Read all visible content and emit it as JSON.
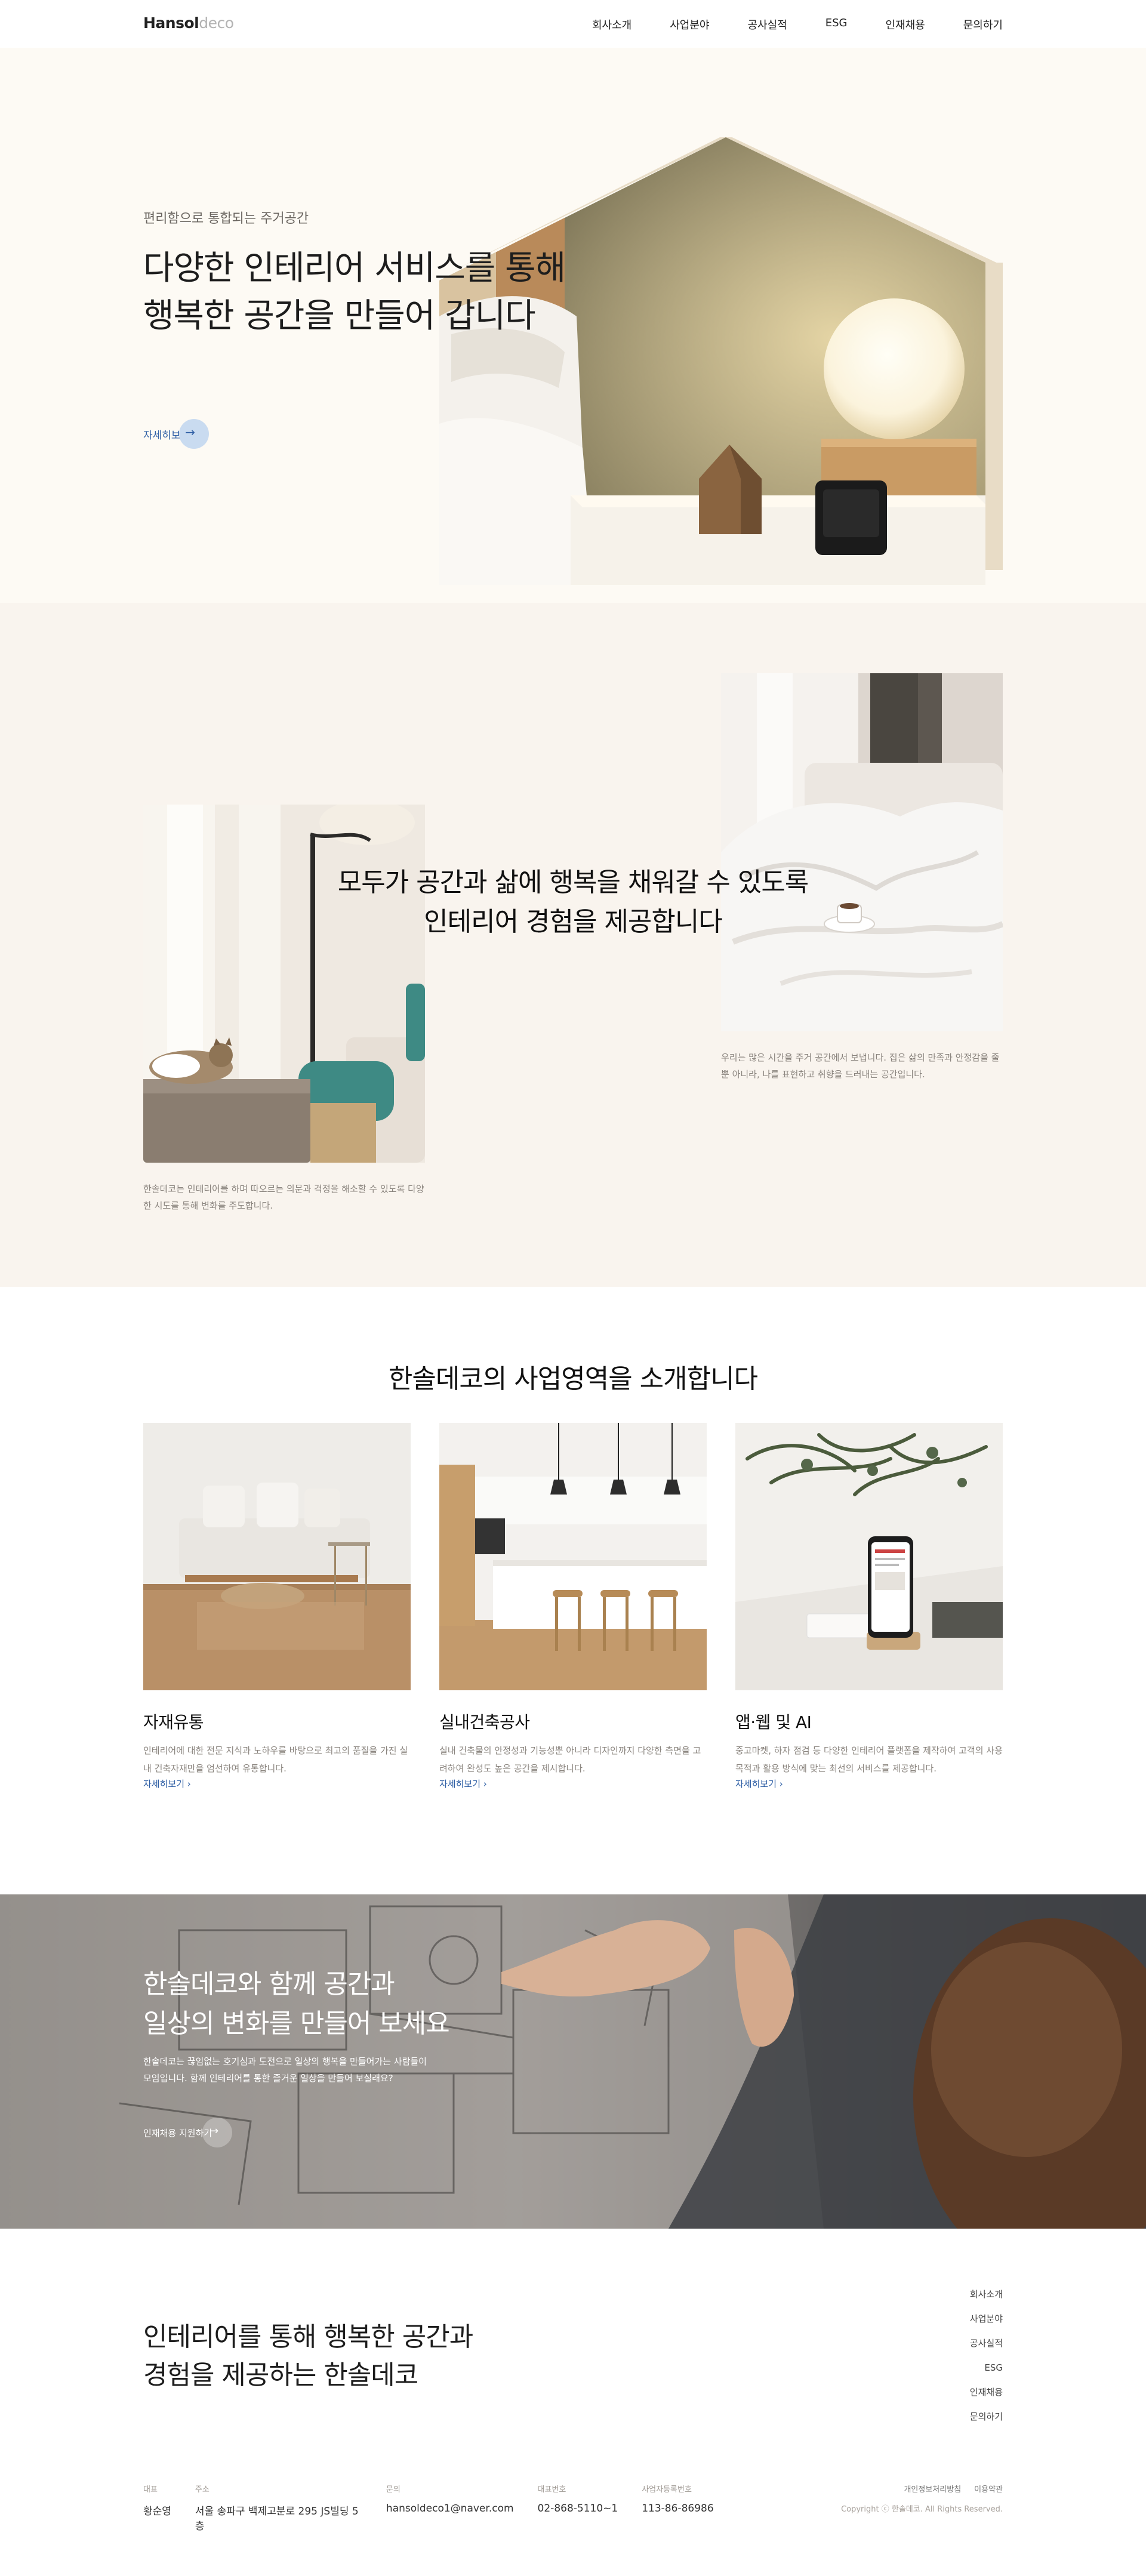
{
  "header": {
    "logo_bold": "Hansol",
    "logo_light": "deco",
    "nav": [
      "회사소개",
      "사업분야",
      "공사실적",
      "ESG",
      "인재채용",
      "문의하기"
    ]
  },
  "hero": {
    "subtitle": "편리함으로 통합되는 주거공간",
    "title_line1": "다양한 인테리어 서비스를 통해",
    "title_line2": "행복한 공간을 만들어 갑니다",
    "more_label": "자세히보기"
  },
  "about": {
    "title_line1": "모두가 공간과 삶에 행복을 채워갈 수 있도록",
    "title_line2": "인테리어 경험을 제공합니다",
    "left_text": "한솔데코는 인테리어를 하며 따오르는 의문과 걱정을 해소할 수 있도록 다양한 시도를 통해 변화를 주도합니다.",
    "right_text": "우리는 많은 시간을 주거 공간에서 보냅니다. 집은 삶의 만족과 안정감을 줄 뿐 아니라, 나를 표현하고 취향을 드러내는 공간입니다."
  },
  "business": {
    "title": "한솔데코의 사업영역을 소개합니다",
    "cards": [
      {
        "title": "자재유통",
        "desc": "인테리어에 대한 전문 지식과 노하우를 바탕으로 최고의 품질을 가진 실내 건축자재만을 엄선하여 유통합니다.",
        "more": "자세히보기"
      },
      {
        "title": "실내건축공사",
        "desc": "실내 건축물의 안정성과 기능성뿐 아니라 디자인까지 다양한 측면을 고려하여 완성도 높은 공간을 제시합니다.",
        "more": "자세히보기"
      },
      {
        "title": "앱·웹 및 AI",
        "desc": "중고마켓, 하자 점검 등 다양한 인테리어 플랫폼을 제작하여 고객의 사용 목적과 활용 방식에 맞는 최선의 서비스를 제공합니다.",
        "more": "자세히보기"
      }
    ]
  },
  "banner": {
    "title_line1": "한솔데코와 함께 공간과",
    "title_line2": "일상의 변화를 만들어 보세요",
    "desc_line1": "한솔데코는 끊임없는 호기심과 도전으로 일상의 행복을 만들어가는 사람들이",
    "desc_line2": "모임입니다. 함께 인테리어를 통한 즐거운 일상을 만들어 보실래요?",
    "more_label": "인재채용 지원하기"
  },
  "footer": {
    "title_line1": "인테리어를 통해 행복한 공간과",
    "title_line2": "경험을 제공하는 한솔데코",
    "nav": [
      "회사소개",
      "사업분야",
      "공사실적",
      "ESG",
      "인재채용",
      "문의하기"
    ],
    "info": [
      {
        "key": "대표",
        "value": "황순영"
      },
      {
        "key": "주소",
        "value": "서울 송파구 백제고분로 295 JS빌딩 5층"
      },
      {
        "key": "문의",
        "value": "hansoldeco1@naver.com"
      },
      {
        "key": "대표번호",
        "value": "02-868-5110~1"
      },
      {
        "key": "사업자등록번호",
        "value": "113-86-86986"
      }
    ],
    "links": [
      "개인정보처리방침",
      "이용약관"
    ],
    "copyright": "Copyright ⓒ 한솔데코. All Rights Reserved."
  }
}
